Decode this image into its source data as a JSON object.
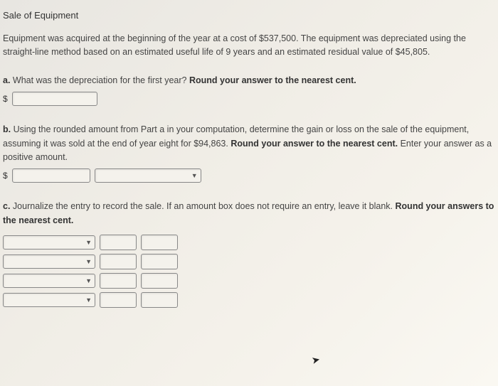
{
  "title": "Sale of Equipment",
  "intro": "Equipment was acquired at the beginning of the year at a cost of $537,500. The equipment was depreciated using the straight-line method based on an estimated useful life of 9 years and an estimated residual value of $45,805.",
  "parts": {
    "a": {
      "label": "a.",
      "text": "What was the depreciation for the first year? ",
      "bold": "Round your answer to the nearest cent.",
      "currency": "$"
    },
    "b": {
      "label": "b.",
      "text1": "Using the rounded amount from Part a in your computation, determine the gain or loss on the sale of the equipment, assuming it was sold at the end of year eight for $94,863. ",
      "bold": "Round your answer to the nearest cent.",
      "text2": " Enter your answer as a positive amount.",
      "currency": "$"
    },
    "c": {
      "label": "c.",
      "text": "Journalize the entry to record the sale. If an amount box does not require an entry, leave it blank. ",
      "bold": "Round your answers to the nearest cent."
    }
  }
}
